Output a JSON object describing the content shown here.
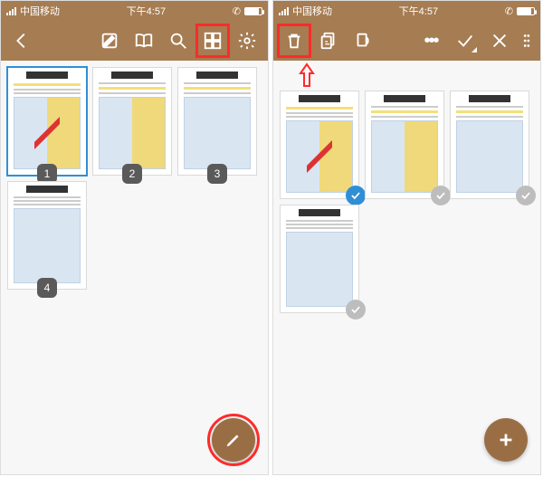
{
  "status": {
    "carrier": "中国移动",
    "time": "下午4:57"
  },
  "left_screen": {
    "pages": [
      {
        "num": "1",
        "selected": true
      },
      {
        "num": "2",
        "selected": false
      },
      {
        "num": "3",
        "selected": false
      },
      {
        "num": "4",
        "selected": false
      }
    ],
    "fab": "pencil"
  },
  "right_screen": {
    "pages": [
      {
        "selected": true
      },
      {
        "selected": false
      },
      {
        "selected": false
      },
      {
        "selected": false
      }
    ],
    "fab": "plus"
  }
}
